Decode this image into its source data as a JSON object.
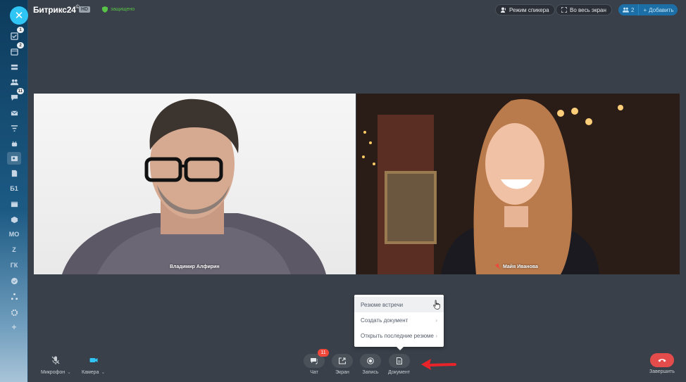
{
  "sidebar": {
    "close_symbol": "✕",
    "items": [
      {
        "icon": "tasks-icon",
        "badge": "1"
      },
      {
        "icon": "calendar-icon",
        "badge": "2"
      },
      {
        "icon": "stack-icon",
        "badge": ""
      },
      {
        "icon": "users-icon",
        "badge": ""
      },
      {
        "icon": "chat-icon",
        "badge": "11"
      },
      {
        "icon": "mail-icon",
        "badge": ""
      },
      {
        "icon": "filter-icon",
        "badge": ""
      },
      {
        "icon": "robot-icon",
        "badge": ""
      },
      {
        "icon": "contact-card-icon",
        "badge": ""
      },
      {
        "icon": "document-icon",
        "badge": ""
      },
      {
        "text": "Б1"
      },
      {
        "icon": "window-icon",
        "badge": ""
      },
      {
        "icon": "box-icon",
        "badge": ""
      },
      {
        "text": "МО"
      },
      {
        "text": "Z"
      },
      {
        "text": "ГК"
      },
      {
        "icon": "check-circle-icon",
        "badge": ""
      },
      {
        "icon": "sitemap-icon",
        "badge": ""
      },
      {
        "icon": "settings-icon",
        "badge": ""
      },
      {
        "text": "+"
      }
    ]
  },
  "header": {
    "brand": "Битрикс24",
    "brand_reg": "©",
    "hd": "HD",
    "secure": "защищено",
    "speaker_mode": "Режим спикера",
    "fullscreen": "Во весь экран",
    "users_count": "2",
    "add": "Добавить"
  },
  "participants": [
    {
      "name": "Владимир Алфирин",
      "muted": false
    },
    {
      "name": "Майя Иванова",
      "muted": true
    }
  ],
  "document_menu": {
    "items": [
      {
        "label": "Резюме встречи",
        "has_submenu": false
      },
      {
        "label": "Создать документ",
        "has_submenu": true
      },
      {
        "label": "Открыть последние резюме",
        "has_submenu": true
      }
    ],
    "chevron": "›"
  },
  "toolbar": {
    "microphone": "Микрофон",
    "camera": "Камера",
    "chat": "Чат",
    "chat_badge": "11",
    "screen": "Экран",
    "record": "Запись",
    "document": "Документ",
    "end": "Завершить",
    "dd_chevron": "⌄"
  },
  "colors": {
    "background": "#3a4049",
    "accent": "#2fc6f6",
    "end_call": "#e44b4b",
    "badge": "#f0473a",
    "secure": "#58c447",
    "arrow": "#e8242a"
  }
}
